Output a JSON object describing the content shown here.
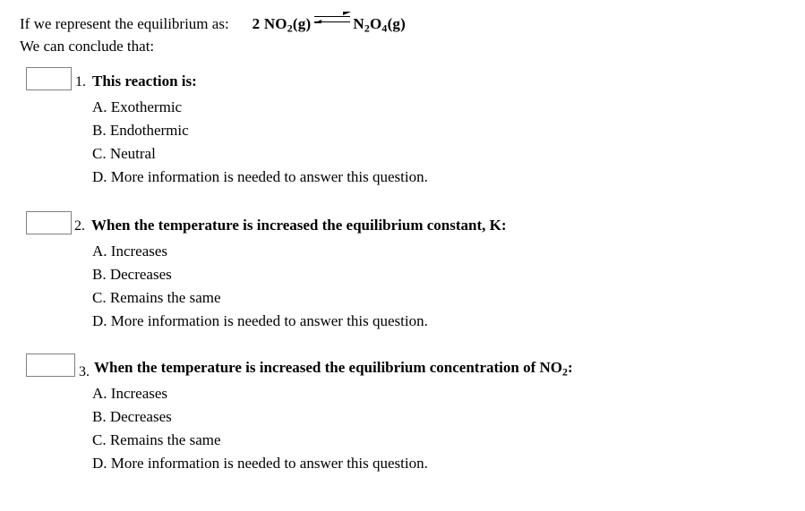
{
  "document": {
    "intro": {
      "lead_text": "If we represent the equilibrium as:",
      "equation": {
        "left_coefficient": "2 ",
        "left_formula_a": "NO",
        "left_sub": "2",
        "left_state": "(g)",
        "arrow_icon": "equilibrium-double-harpoon",
        "right_formula_a": "N",
        "right_sub_a": "2",
        "right_formula_b": "O",
        "right_sub_b": "4",
        "right_state": "(g)"
      },
      "conclude_text": "We can conclude that:"
    },
    "questions": [
      {
        "number": "1.",
        "answer_value": "",
        "text": "This reaction is:",
        "options": [
          "A. Exothermic",
          "B. Endothermic",
          "C. Neutral",
          "D. More information is needed to answer this question."
        ]
      },
      {
        "number": "2.",
        "answer_value": "",
        "text": "When the temperature is increased the equilibrium constant, K:",
        "options": [
          "A. Increases",
          "B. Decreases",
          "C. Remains the same",
          "D. More information is needed to answer this question."
        ]
      },
      {
        "number": "3.",
        "answer_value": "",
        "text_pre": "When the temperature is increased the equilibrium concentration of NO",
        "text_sub": "2",
        "text_post": ":",
        "options": [
          "A. Increases",
          "B. Decreases",
          "C. Remains the same",
          "D. More information is needed to answer this question."
        ]
      }
    ]
  },
  "colors": {
    "background": "#ffffff",
    "text": "#000000",
    "box_border": "#808080"
  }
}
